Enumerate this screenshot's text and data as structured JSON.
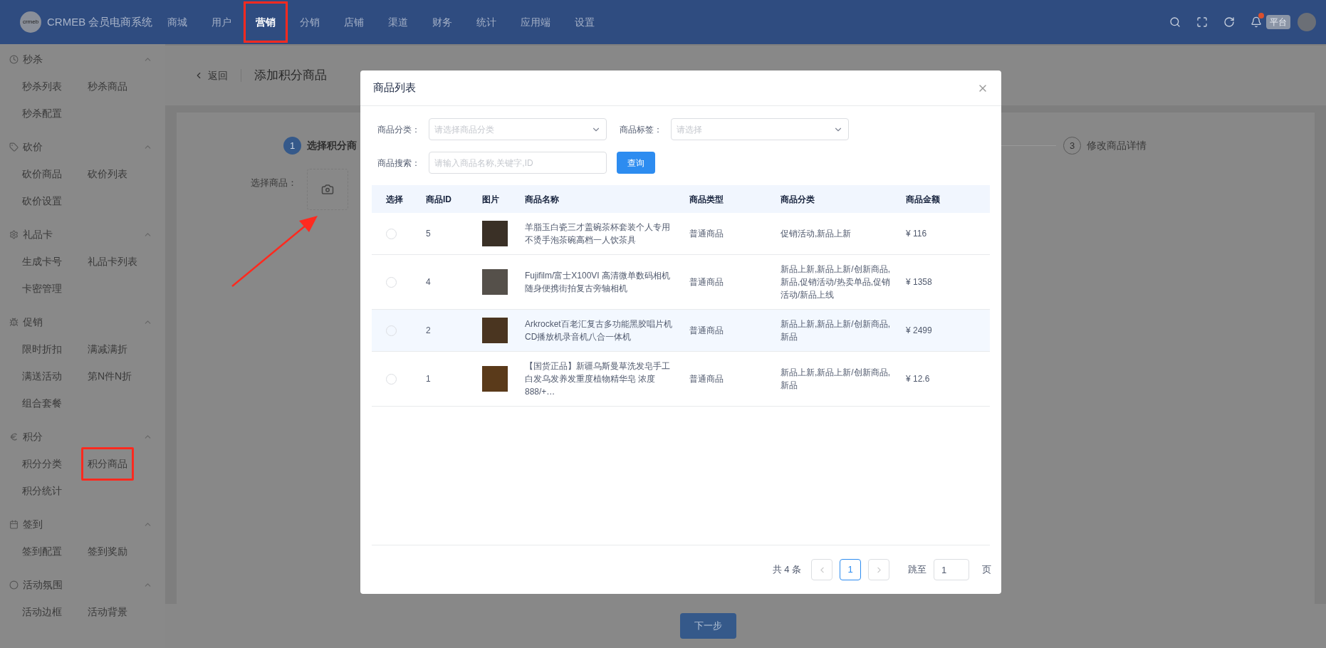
{
  "topbar": {
    "logo_text": "CRMEB 会员电商系统",
    "logo_mark": "crmeb",
    "nav": [
      {
        "label": "商城",
        "selected": false,
        "highlighted": false
      },
      {
        "label": "用户",
        "selected": false,
        "highlighted": false
      },
      {
        "label": "营销",
        "selected": true,
        "highlighted": true
      },
      {
        "label": "分销",
        "selected": false,
        "highlighted": false
      },
      {
        "label": "店铺",
        "selected": false,
        "highlighted": false
      },
      {
        "label": "渠道",
        "selected": false,
        "highlighted": false
      },
      {
        "label": "财务",
        "selected": false,
        "highlighted": false
      },
      {
        "label": "统计",
        "selected": false,
        "highlighted": false
      },
      {
        "label": "应用端",
        "selected": false,
        "highlighted": false
      },
      {
        "label": "设置",
        "selected": false,
        "highlighted": false
      }
    ],
    "notification_dot": true,
    "platform_tag": "平台"
  },
  "sidebar": {
    "groups": [
      {
        "title": "秒杀",
        "expanded": true,
        "items": [
          {
            "label": "秒杀列表",
            "highlighted": false
          },
          {
            "label": "秒杀商品",
            "highlighted": false
          },
          {
            "label": "秒杀配置",
            "highlighted": false
          }
        ]
      },
      {
        "title": "砍价",
        "expanded": true,
        "items": [
          {
            "label": "砍价商品",
            "highlighted": false
          },
          {
            "label": "砍价列表",
            "highlighted": false
          },
          {
            "label": "砍价设置",
            "highlighted": false
          }
        ]
      },
      {
        "title": "礼品卡",
        "expanded": true,
        "items": [
          {
            "label": "生成卡号",
            "highlighted": false
          },
          {
            "label": "礼品卡列表",
            "highlighted": false
          },
          {
            "label": "卡密管理",
            "highlighted": false
          }
        ]
      },
      {
        "title": "促销",
        "expanded": true,
        "items": [
          {
            "label": "限时折扣",
            "highlighted": false
          },
          {
            "label": "满减满折",
            "highlighted": false
          },
          {
            "label": "满送活动",
            "highlighted": false
          },
          {
            "label": "第N件N折",
            "highlighted": false
          },
          {
            "label": "组合套餐",
            "highlighted": false
          }
        ]
      },
      {
        "title": "积分",
        "expanded": true,
        "items": [
          {
            "label": "积分分类",
            "highlighted": false
          },
          {
            "label": "积分商品",
            "highlighted": true
          },
          {
            "label": "积分统计",
            "highlighted": false
          }
        ]
      },
      {
        "title": "签到",
        "expanded": true,
        "items": [
          {
            "label": "签到配置",
            "highlighted": false
          },
          {
            "label": "签到奖励",
            "highlighted": false
          }
        ]
      },
      {
        "title": "活动氛围",
        "expanded": true,
        "items": [
          {
            "label": "活动边框",
            "highlighted": false
          },
          {
            "label": "活动背景",
            "highlighted": false
          }
        ]
      }
    ]
  },
  "page": {
    "back": "返回",
    "title": "添加积分商品",
    "steps": [
      {
        "number": "1",
        "label": "选择积分商",
        "active": true
      },
      {
        "number": "3",
        "label": "修改商品详情",
        "active": false
      }
    ],
    "field_label": "选择商品：",
    "next_button": "下一步"
  },
  "modal": {
    "title": "商品列表",
    "filters": [
      {
        "label": "商品分类：",
        "placeholder": "请选择商品分类"
      },
      {
        "label": "商品标签：",
        "placeholder": "请选择"
      }
    ],
    "search": {
      "label": "商品搜索：",
      "placeholder": "请输入商品名称,关键字,ID"
    },
    "query_button": "查询",
    "columns": [
      "选择",
      "商品ID",
      "图片",
      "商品名称",
      "商品类型",
      "商品分类",
      "商品金额"
    ],
    "rows": [
      {
        "selected": false,
        "highlighted": false,
        "id": "5",
        "name": "羊脂玉白瓷三才盖碗茶杯套装个人专用不烫手泡茶碗高档一人饮茶具",
        "type": "普通商品",
        "category": "促销活动,新品上新",
        "price": "¥ 116"
      },
      {
        "selected": false,
        "highlighted": false,
        "id": "4",
        "name": "Fujifilm/富士X100VI 高清微单数码相机随身便携街拍复古旁轴相机",
        "type": "普通商品",
        "category": "新品上新,新品上新/创新商品,新品,促销活动/热卖单品,促销活动/新品上线",
        "price": "¥ 1358"
      },
      {
        "selected": false,
        "highlighted": true,
        "id": "2",
        "name": "Arkrocket百老汇复古多功能黑胶唱片机CD播放机录音机八合一体机",
        "type": "普通商品",
        "category": "新品上新,新品上新/创新商品,新品",
        "price": "¥ 2499"
      },
      {
        "selected": false,
        "highlighted": false,
        "id": "1",
        "name": "【国货正品】新疆乌斯曼草洗发皂手工白发乌发养发重度植物精华皂 浓度888/+…",
        "type": "普通商品",
        "category": "新品上新,新品上新/创新商品,新品",
        "price": "¥ 12.6"
      }
    ],
    "pagination": {
      "total": "共 4 条",
      "prev_disabled": true,
      "next_disabled": true,
      "pages": [
        {
          "label": "1",
          "selected": true
        }
      ],
      "jump_label": "跳至",
      "jump_value": "1",
      "suffix": "页"
    }
  }
}
